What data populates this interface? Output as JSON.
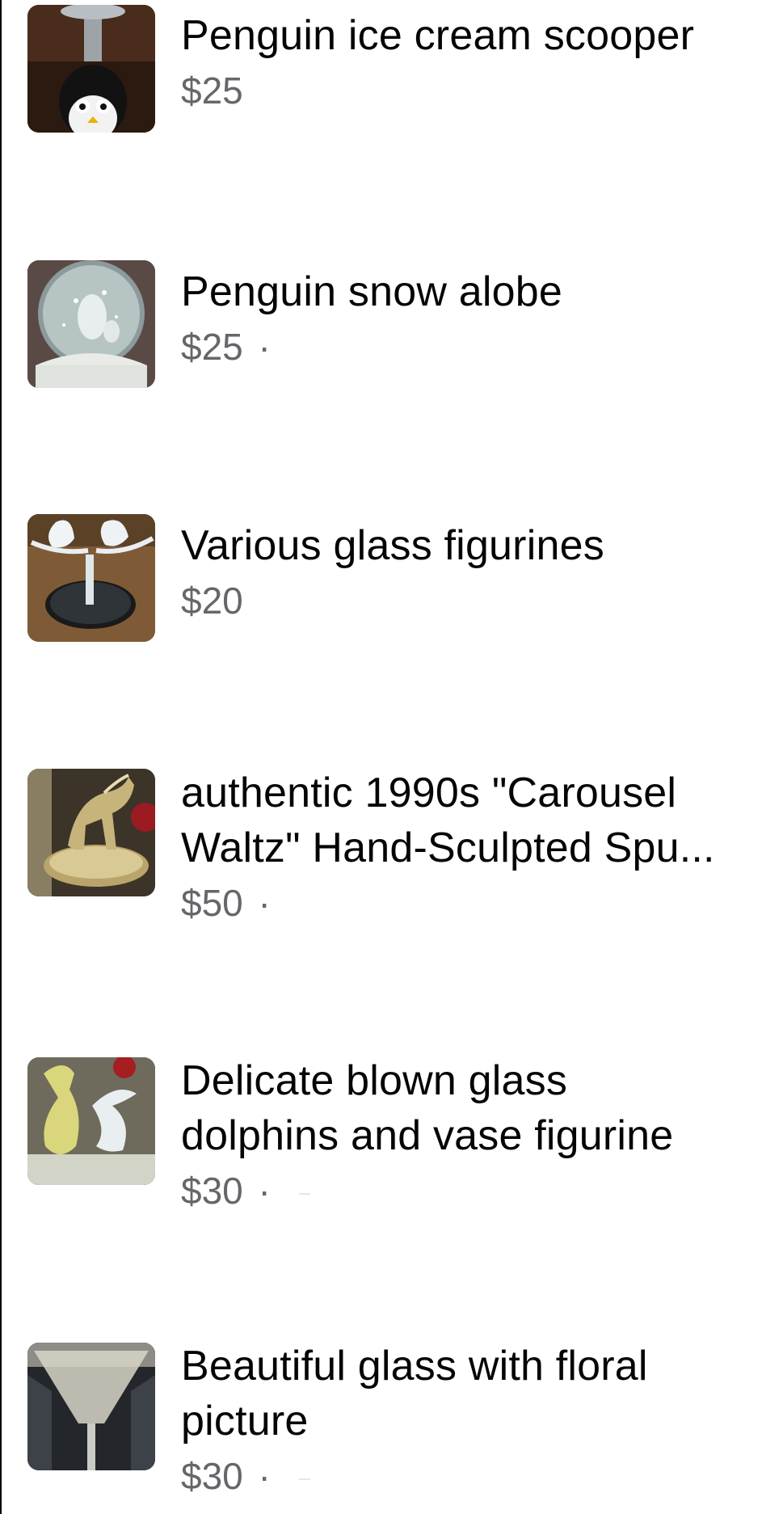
{
  "listings": [
    {
      "title": "Penguin ice cream scooper",
      "price": "$25",
      "dot": ""
    },
    {
      "title": "Penguin snow alobe",
      "price": "$25",
      "dot": "·"
    },
    {
      "title": "Various glass figurines",
      "price": "$20",
      "dot": ""
    },
    {
      "title_line1": "authentic 1990s \"Carousel",
      "title_line2": "Waltz\" Hand-Sculpted Spu...",
      "price": "$50",
      "dot": "·"
    },
    {
      "title_line1": "Delicate blown glass",
      "title_line2": "dolphins and vase figurine",
      "price": "$30",
      "dot": "·"
    },
    {
      "title_line1": "Beautiful glass with floral",
      "title_line2": "picture",
      "price": "$30",
      "dot": "·"
    }
  ],
  "thumbnails": [
    {
      "name": "penguin-scooper-photo",
      "colors": {
        "bg": "#3a2418",
        "accent": "#1a1a1a"
      }
    },
    {
      "name": "snow-globe-photo",
      "colors": {
        "bg": "#6b5a55",
        "accent": "#d9dde0"
      }
    },
    {
      "name": "glass-figurines-photo",
      "colors": {
        "bg": "#7a5a36",
        "accent": "#e8ecef"
      }
    },
    {
      "name": "carousel-figurine-photo",
      "colors": {
        "bg": "#4a4030",
        "accent": "#c9b78a"
      }
    },
    {
      "name": "blown-glass-dolphins-photo",
      "colors": {
        "bg": "#6a6858",
        "accent": "#e3e07a"
      }
    },
    {
      "name": "floral-glass-photo",
      "colors": {
        "bg": "#2a2e32",
        "accent": "#cfd0c8"
      }
    }
  ]
}
